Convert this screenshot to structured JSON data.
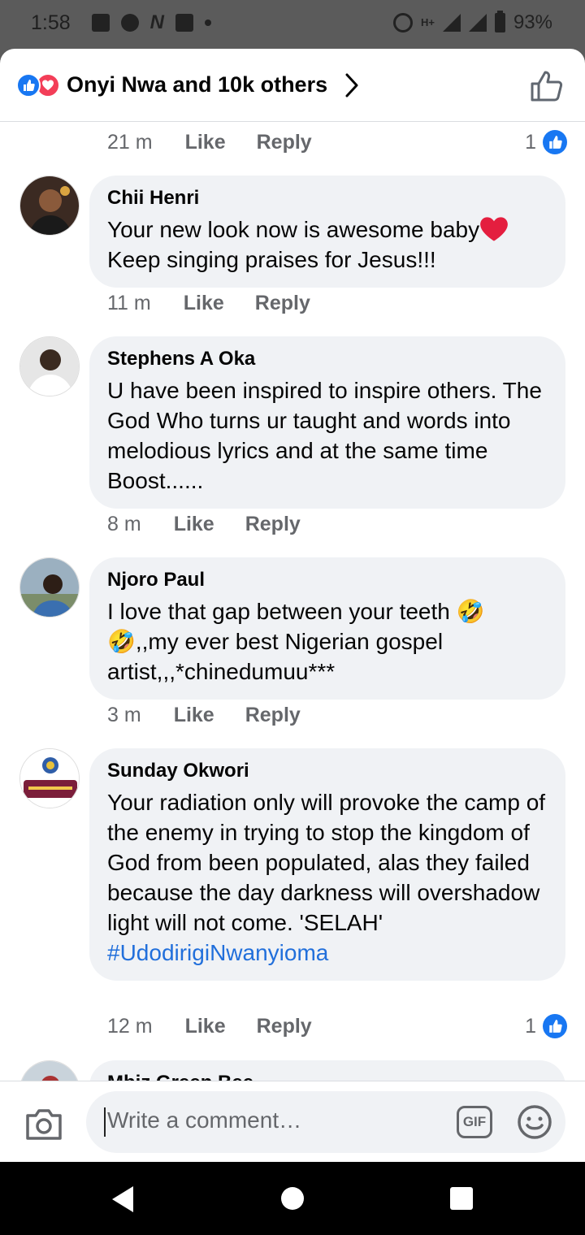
{
  "status_bar": {
    "time": "1:58",
    "network_label": "H+",
    "battery": "93%"
  },
  "header": {
    "reactions_summary": "Onyi Nwa and 10k others"
  },
  "top_meta": {
    "time": "21 m",
    "like_label": "Like",
    "reply_label": "Reply",
    "reaction_count": "1"
  },
  "comments": [
    {
      "author": "Chii Henri",
      "text_line1": "Your new look now is awesome baby",
      "text_line2": "Keep singing praises for Jesus!!!",
      "time": "11 m",
      "like_label": "Like",
      "reply_label": "Reply"
    },
    {
      "author": "Stephens A Oka",
      "text": "U have  been inspired to inspire others. The God Who turns ur taught and words into melodious  lyrics and at the  same time Boost......",
      "time": "8 m",
      "like_label": "Like",
      "reply_label": "Reply"
    },
    {
      "author": "Njoro Paul",
      "text": "I love that gap between your teeth 🤣 🤣,,my ever best Nigerian gospel artist,,,*chinedumuu***",
      "time": "3 m",
      "like_label": "Like",
      "reply_label": "Reply"
    },
    {
      "author": "Sunday Okwori",
      "text": "Your radiation only will provoke the camp of the enemy in trying to stop the kingdom of God from been populated, alas they failed because the day darkness will overshadow light will not come. 'SELAH'",
      "hashtag": "#UdodirigiNwanyioma",
      "time": "12 m",
      "like_label": "Like",
      "reply_label": "Reply",
      "reaction_count": "1"
    },
    {
      "author": "Mbiz Green Bee"
    }
  ],
  "composer": {
    "placeholder": "Write a comment…",
    "gif_label": "GIF"
  },
  "colors": {
    "accent": "#1877f2",
    "love": "#f33e58",
    "bubble": "#f0f2f5",
    "meta_text": "#65676b",
    "hashtag": "#216fdb"
  }
}
